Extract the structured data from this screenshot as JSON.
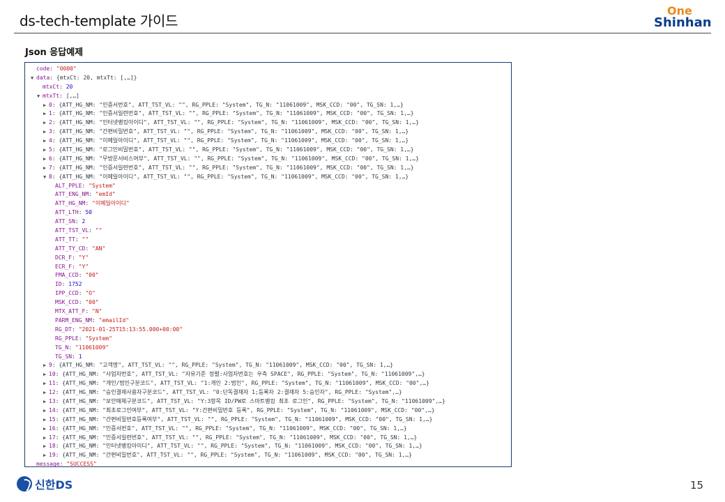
{
  "header": {
    "title": "ds-tech-template 가이드",
    "logo_top": "One",
    "logo_bottom": "Shinhan"
  },
  "section_title": "Json 응답예제",
  "json_lines": [
    {
      "indent": 0,
      "tri": "",
      "key": "code",
      "val": "\"0000\"",
      "t": "s"
    },
    {
      "indent": 0,
      "tri": "▼",
      "key": "data",
      "val": "{mtxCt: 20, mtxTt: [,…]}",
      "t": "p"
    },
    {
      "indent": 1,
      "tri": "",
      "key": "mtxCt",
      "val": "20",
      "t": "n"
    },
    {
      "indent": 1,
      "tri": "▼",
      "key": "mtxTt",
      "val": "[,…]",
      "t": "p"
    },
    {
      "indent": 2,
      "tri": "▶",
      "key": "0",
      "val": "{ATT_HG_NM: \"인증서번호\", ATT_TST_VL: \"\", RG_PPLE: \"System\", TG_N: \"11061009\", MSK_CCD: \"00\", TG_SN: 1,…}",
      "t": "p"
    },
    {
      "indent": 2,
      "tri": "▶",
      "key": "1",
      "val": "{ATT_HG_NM: \"인증서일련번호\", ATT_TST_VL: \"\", RG_PPLE: \"System\", TG_N: \"11061009\", MSK_CCD: \"00\", TG_SN: 1,…}",
      "t": "p"
    },
    {
      "indent": 2,
      "tri": "▶",
      "key": "2",
      "val": "{ATT_HG_NM: \"인터넷뱅킹아이디\", ATT_TST_VL: \"\", RG_PPLE: \"System\", TG_N: \"11061009\", MSK_CCD: \"00\", TG_SN: 1,…}",
      "t": "p"
    },
    {
      "indent": 2,
      "tri": "▶",
      "key": "3",
      "val": "{ATT_HG_NM: \"간편비밀번호\", ATT_TST_VL: \"\", RG_PPLE: \"System\", TG_N: \"11061009\", MSK_CCD: \"00\", TG_SN: 1,…}",
      "t": "p"
    },
    {
      "indent": 2,
      "tri": "▶",
      "key": "4",
      "val": "{ATT_HG_NM: \"이메일아이디\", ATT_TST_VL: \"\", RG_PPLE: \"System\", TG_N: \"11061009\", MSK_CCD: \"00\", TG_SN: 1,…}",
      "t": "p"
    },
    {
      "indent": 2,
      "tri": "▶",
      "key": "5",
      "val": "{ATT_HG_NM: \"로그인비밀번호\", ATT_TST_VL: \"\", RG_PPLE: \"System\", TG_N: \"11061009\", MSK_CCD: \"00\", TG_SN: 1,…}",
      "t": "p"
    },
    {
      "indent": 2,
      "tri": "▶",
      "key": "6",
      "val": "{ATT_HG_NM: \"무방문서비스여부\", ATT_TST_VL: \"\", RG_PPLE: \"System\", TG_N: \"11061009\", MSK_CCD: \"00\", TG_SN: 1,…}",
      "t": "p"
    },
    {
      "indent": 2,
      "tri": "▶",
      "key": "7",
      "val": "{ATT_HG_NM: \"인증서일련번호\", ATT_TST_VL: \"\", RG_PPLE: \"System\", TG_N: \"11061009\", MSK_CCD: \"00\", TG_SN: 1,…}",
      "t": "p"
    },
    {
      "indent": 2,
      "tri": "▼",
      "key": "8",
      "val": "{ATT_HG_NM: \"이메일아이디\", ATT_TST_VL: \"\", RG_PPLE: \"System\", TG_N: \"11061009\", MSK_CCD: \"00\", TG_SN: 1,…}",
      "t": "p"
    },
    {
      "indent": 3,
      "tri": "",
      "key": "ALT_PPLE",
      "val": "\"System\"",
      "t": "s"
    },
    {
      "indent": 3,
      "tri": "",
      "key": "ATT_ENG_NM",
      "val": "\"emId\"",
      "t": "s"
    },
    {
      "indent": 3,
      "tri": "",
      "key": "ATT_HG_NM",
      "val": "\"이메일아이디\"",
      "t": "s"
    },
    {
      "indent": 3,
      "tri": "",
      "key": "ATT_LTH",
      "val": "50",
      "t": "n"
    },
    {
      "indent": 3,
      "tri": "",
      "key": "ATT_SN",
      "val": "2",
      "t": "n"
    },
    {
      "indent": 3,
      "tri": "",
      "key": "ATT_TST_VL",
      "val": "\"\"",
      "t": "s"
    },
    {
      "indent": 3,
      "tri": "",
      "key": "ATT_TT",
      "val": "\"\"",
      "t": "s"
    },
    {
      "indent": 3,
      "tri": "",
      "key": "ATT_TY_CD",
      "val": "\"AN\"",
      "t": "s"
    },
    {
      "indent": 3,
      "tri": "",
      "key": "DCR_F",
      "val": "\"Y\"",
      "t": "s"
    },
    {
      "indent": 3,
      "tri": "",
      "key": "ECR_F",
      "val": "\"Y\"",
      "t": "s"
    },
    {
      "indent": 3,
      "tri": "",
      "key": "FMA_CCD",
      "val": "\"00\"",
      "t": "s"
    },
    {
      "indent": 3,
      "tri": "",
      "key": "ID",
      "val": "1752",
      "t": "n"
    },
    {
      "indent": 3,
      "tri": "",
      "key": "IPP_CCD",
      "val": "\"O\"",
      "t": "s"
    },
    {
      "indent": 3,
      "tri": "",
      "key": "MSK_CCD",
      "val": "\"00\"",
      "t": "s"
    },
    {
      "indent": 3,
      "tri": "",
      "key": "MTX_ATT_F",
      "val": "\"N\"",
      "t": "s"
    },
    {
      "indent": 3,
      "tri": "",
      "key": "PARM_ENG_NM",
      "val": "\"emailId\"",
      "t": "s"
    },
    {
      "indent": 3,
      "tri": "",
      "key": "RG_DT",
      "val": "\"2021-01-25T15:13:55.000+00:00\"",
      "t": "s"
    },
    {
      "indent": 3,
      "tri": "",
      "key": "RG_PPLE",
      "val": "\"System\"",
      "t": "s"
    },
    {
      "indent": 3,
      "tri": "",
      "key": "TG_N",
      "val": "\"11061009\"",
      "t": "s"
    },
    {
      "indent": 3,
      "tri": "",
      "key": "TG_SN",
      "val": "1",
      "t": "n"
    },
    {
      "indent": 2,
      "tri": "▶",
      "key": "9",
      "val": "{ATT_HG_NM: \"고객명\", ATT_TST_VL: \"\", RG_PPLE: \"System\", TG_N: \"11061009\", MSK_CCD: \"00\", TG_SN: 1,…}",
      "t": "p"
    },
    {
      "indent": 2,
      "tri": "▶",
      "key": "10",
      "val": "{ATT_HG_NM: \"사업자번호\", ATT_TST_VL: \"자유기준 정렬:사업자번호는 우측 SPACE\", RG_PPLE: \"System\", TG_N: \"11061009\",…}",
      "t": "p"
    },
    {
      "indent": 2,
      "tri": "▶",
      "key": "11",
      "val": "{ATT_HG_NM: \"개인/법인구분코드\", ATT_TST_VL: \"1:개인 2:법인\", RG_PPLE: \"System\", TG_N: \"11061009\", MSK_CCD: \"00\",…}",
      "t": "p"
    },
    {
      "indent": 2,
      "tri": "▶",
      "key": "12",
      "val": "{ATT_HG_NM: \"승인결재사용자구분코드\", ATT_TST_VL: \"0:단독결재자 1;등록자 2:결재자 5:승인자\", RG_PPLE: \"System\",…}",
      "t": "p"
    },
    {
      "indent": 2,
      "tri": "▶",
      "key": "13",
      "val": "{ATT_HG_NM: \"보안매체구분코드\", ATT_TST_VL: \"Y:3항목 ID/PW로 스마트뱅킹 최초 로그인\", RG_PPLE: \"System\", TG_N: \"11061009\",…}",
      "t": "p"
    },
    {
      "indent": 2,
      "tri": "▶",
      "key": "14",
      "val": "{ATT_HG_NM: \"최초로그인여부\", ATT_TST_VL: \"Y:간편비밀번호 등록\", RG_PPLE: \"System\", TG_N: \"11061009\", MSK_CCD: \"00\",…}",
      "t": "p"
    },
    {
      "indent": 2,
      "tri": "▶",
      "key": "15",
      "val": "{ATT_HG_NM: \"간편비밀번호등록여부\", ATT_TST_VL: \"\", RG_PPLE: \"System\", TG_N: \"11061009\", MSK_CCD: \"00\", TG_SN: 1,…}",
      "t": "p"
    },
    {
      "indent": 2,
      "tri": "▶",
      "key": "16",
      "val": "{ATT_HG_NM: \"인증서번호\", ATT_TST_VL: \"\", RG_PPLE: \"System\", TG_N: \"11061009\", MSK_CCD: \"00\", TG_SN: 1,…}",
      "t": "p"
    },
    {
      "indent": 2,
      "tri": "▶",
      "key": "17",
      "val": "{ATT_HG_NM: \"인증서일련번호\", ATT_TST_VL: \"\", RG_PPLE: \"System\", TG_N: \"11061009\", MSK_CCD: \"00\", TG_SN: 1,…}",
      "t": "p"
    },
    {
      "indent": 2,
      "tri": "▶",
      "key": "18",
      "val": "{ATT_HG_NM: \"인터넷뱅킹아이디\", ATT_TST_VL: \"\", RG_PPLE: \"System\", TG_N: \"11061009\", MSK_CCD: \"00\", TG_SN: 1,…}",
      "t": "p"
    },
    {
      "indent": 2,
      "tri": "▶",
      "key": "19",
      "val": "{ATT_HG_NM: \"간편비밀번호\", ATT_TST_VL: \"\", RG_PPLE: \"System\", TG_N: \"11061009\", MSK_CCD: \"00\", TG_SN: 1,…}",
      "t": "p"
    },
    {
      "indent": 0,
      "tri": "",
      "key": "message",
      "val": "\"SUCCESS\"",
      "t": "s"
    }
  ],
  "footer": {
    "brand": "신한DS",
    "page_number": "15"
  },
  "colors": {
    "brand_blue": "#0a3d8c",
    "brand_orange": "#e8891a",
    "panel_border": "#1e3a6e"
  }
}
